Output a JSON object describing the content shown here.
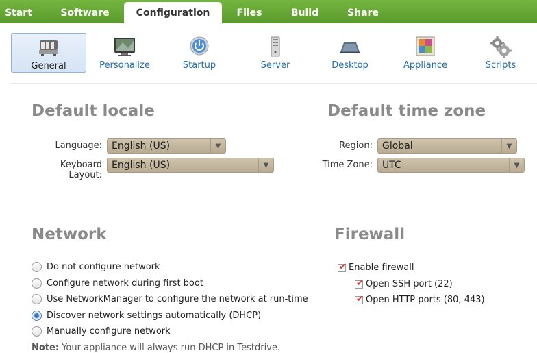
{
  "tabs": [
    {
      "label": "Start"
    },
    {
      "label": "Software"
    },
    {
      "label": "Configuration"
    },
    {
      "label": "Files"
    },
    {
      "label": "Build"
    },
    {
      "label": "Share"
    }
  ],
  "active_tab": "Configuration",
  "subnav": [
    {
      "label": "General",
      "icon": "general-icon"
    },
    {
      "label": "Personalize",
      "icon": "monitor-icon"
    },
    {
      "label": "Startup",
      "icon": "power-icon"
    },
    {
      "label": "Server",
      "icon": "server-icon"
    },
    {
      "label": "Desktop",
      "icon": "desktop-icon"
    },
    {
      "label": "Appliance",
      "icon": "appliance-icon"
    },
    {
      "label": "Scripts",
      "icon": "gears-icon"
    }
  ],
  "active_subnav": "General",
  "locale": {
    "title": "Default locale",
    "language_label": "Language:",
    "language_value": "English (US)",
    "keyboard_label": "Keyboard Layout:",
    "keyboard_value": "English (US)"
  },
  "timezone": {
    "title": "Default time zone",
    "region_label": "Region:",
    "region_value": "Global",
    "tz_label": "Time Zone:",
    "tz_value": "UTC"
  },
  "network": {
    "title": "Network",
    "options": [
      {
        "label": "Do not configure network",
        "checked": false
      },
      {
        "label": "Configure network during first boot",
        "checked": false
      },
      {
        "label": "Use NetworkManager to configure the network at run-time",
        "checked": false
      },
      {
        "label": "Discover network settings automatically (DHCP)",
        "checked": true
      },
      {
        "label": "Manually configure network",
        "checked": false
      }
    ],
    "note_label": "Note:",
    "note_text": "Your appliance will always run DHCP in Testdrive."
  },
  "firewall": {
    "title": "Firewall",
    "enable_label": "Enable firewall",
    "ssh_label": "Open SSH port (22)",
    "http_label": "Open HTTP ports (80, 443)",
    "checkmark": "✔"
  },
  "colors": {
    "tabbar": "#5f9e32",
    "link": "#1f6fb2",
    "heading": "#8a8a8a",
    "check": "#d9342b"
  }
}
